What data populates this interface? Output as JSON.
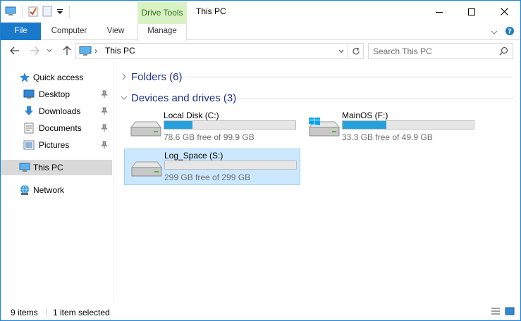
{
  "window": {
    "title": "This PC",
    "context_tab_header": "Drive Tools",
    "accent_color": "#1979ca",
    "context_color": "#d9f2c4"
  },
  "quick_access_toolbar": {
    "icons": [
      "computer-icon",
      "properties-check-icon",
      "new-folder-icon",
      "customize-dropdown-icon"
    ]
  },
  "ribbon": {
    "tabs": [
      {
        "label": "File",
        "active": false
      },
      {
        "label": "Computer",
        "active": false
      },
      {
        "label": "View",
        "active": false
      },
      {
        "label": "Manage",
        "active": true
      }
    ]
  },
  "address_bar": {
    "path": "This PC",
    "search_placeholder": "Search This PC"
  },
  "nav_pane": {
    "quick_access": {
      "label": "Quick access"
    },
    "quick_items": [
      {
        "label": "Desktop",
        "icon": "desktop-icon",
        "pinned": true
      },
      {
        "label": "Downloads",
        "icon": "downloads-icon",
        "pinned": true
      },
      {
        "label": "Documents",
        "icon": "documents-icon",
        "pinned": true
      },
      {
        "label": "Pictures",
        "icon": "pictures-icon",
        "pinned": true
      }
    ],
    "this_pc": {
      "label": "This PC",
      "selected": true
    },
    "network": {
      "label": "Network"
    }
  },
  "content": {
    "folders_group": {
      "title": "Folders (6)",
      "expanded": false
    },
    "devices_group": {
      "title": "Devices and drives (3)",
      "expanded": true
    },
    "drives": [
      {
        "name": "Local Disk (C:)",
        "free_text": "78.6 GB free of 99.9 GB",
        "used_fraction": 0.213,
        "selected": false,
        "icon": "hard-drive-icon"
      },
      {
        "name": "MainOS (F:)",
        "free_text": "33.3 GB free of 49.9 GB",
        "used_fraction": 0.333,
        "selected": false,
        "icon": "windows-drive-icon"
      },
      {
        "name": "Log_Space (S:)",
        "free_text": "299 GB free of 299 GB",
        "used_fraction": 0.0,
        "selected": true,
        "icon": "hard-drive-icon"
      }
    ]
  },
  "status_bar": {
    "item_count": "9 items",
    "selection": "1 item selected"
  }
}
